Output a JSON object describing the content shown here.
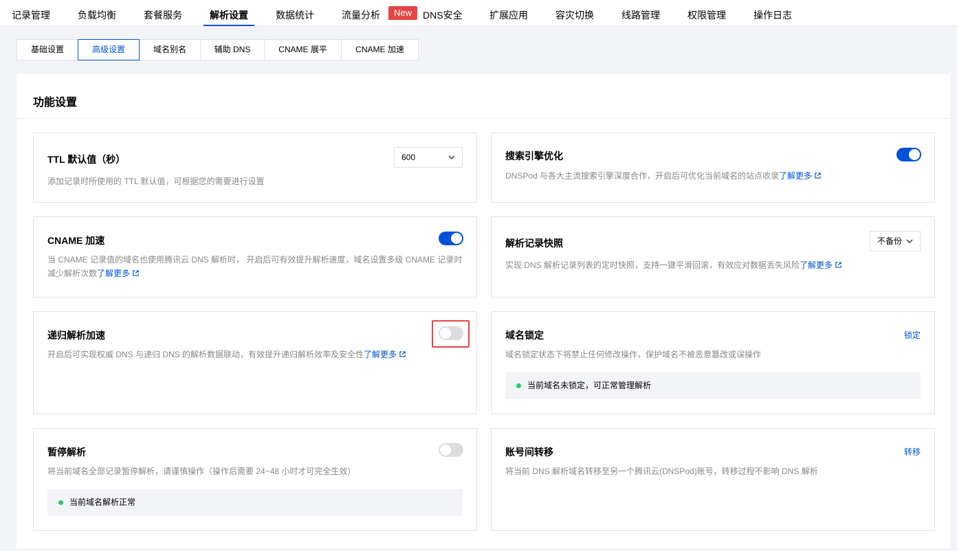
{
  "topnav": {
    "tabs": [
      "记录管理",
      "负载均衡",
      "套餐服务",
      "解析设置",
      "数据统计",
      "流量分析",
      "DNS安全",
      "扩展应用",
      "容灾切换",
      "线路管理",
      "权限管理",
      "操作日志"
    ],
    "active": "解析设置",
    "new_badge": "New"
  },
  "subtabs": {
    "items": [
      "基础设置",
      "高级设置",
      "域名别名",
      "辅助 DNS",
      "CNAME 展平",
      "CNAME 加速"
    ],
    "active": "高级设置"
  },
  "panel": {
    "title": "功能设置"
  },
  "learn_more": "了解更多",
  "cards": {
    "ttl": {
      "title": "TTL 默认值（秒）",
      "desc": "添加记录时所使用的 TTL 默认值，可根据您的需要进行设置",
      "value": "600"
    },
    "seo": {
      "title": "搜索引擎优化",
      "desc": "DNSPod 与各大主流搜索引擎深度合作，开启后可优化当前域名的站点收录",
      "enabled": true
    },
    "cname": {
      "title": "CNAME 加速",
      "desc_line1": "当 CNAME 记录值的域名也使用腾讯云 DNS 解析时， 开启后可有效提升解析速度，域名设置多级 CNAME 记录时",
      "desc_line2": "减少解析次数",
      "enabled": true
    },
    "snapshot": {
      "title": "解析记录快照",
      "desc": "实现 DNS 解析记录列表的定时快照，支持一键平滑回滚，有效应对数据丢失风险",
      "value": "不备份"
    },
    "recursive": {
      "title": "递归解析加速",
      "desc": "开启后可实现权威 DNS 与递归 DNS 的解析数据联动，有效提升递归解析效率及安全性",
      "enabled": false
    },
    "lock": {
      "title": "域名锁定",
      "action": "锁定",
      "desc": "域名锁定状态下将禁止任何修改操作，保护域名不被恶意篡改或误操作",
      "status": "当前域名未锁定，可正常管理解析"
    },
    "pause": {
      "title": "暂停解析",
      "desc": "将当前域名全部记录暂停解析，请谨慎操作（操作后需要 24~48 小时才可完全生效）",
      "enabled": false,
      "status": "当前域名解析正常"
    },
    "transfer": {
      "title": "账号间转移",
      "action": "转移",
      "desc": "将当前 DNS 解析域名转移至另一个腾讯云(DNSPod)账号，转移过程不影响 DNS 解析"
    }
  },
  "colors": {
    "brand": "#0052d9",
    "danger": "#e54545",
    "success": "#29cc6a"
  }
}
